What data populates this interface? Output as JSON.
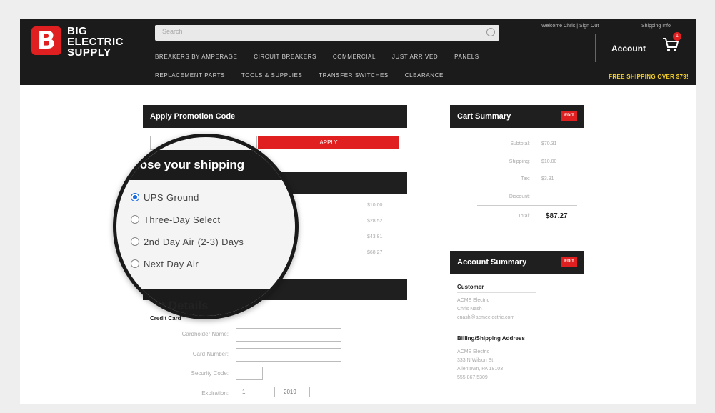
{
  "brand": {
    "line1": "BIG",
    "line2": "ELECTRIC",
    "line3": "SUPPLY",
    "logo_letter": "B"
  },
  "header": {
    "search_placeholder": "Search",
    "welcome": "Welcome Chris | Sign Out",
    "shipping_link": "Shipping Info",
    "account": "Account",
    "cart_count": "1",
    "free_shipping": "FREE SHIPPING OVER $79!",
    "nav_row1": [
      "BREAKERS BY AMPERAGE",
      "CIRCUIT BREAKERS",
      "COMMERCIAL",
      "JUST ARRIVED",
      "PANELS"
    ],
    "nav_row2": [
      "REPLACEMENT PARTS",
      "TOOLS & SUPPLIES",
      "TRANSFER SWITCHES",
      "CLEARANCE"
    ]
  },
  "promo": {
    "title": "Apply Promotion Code",
    "apply_label": "APPLY"
  },
  "shipping": {
    "magnified_heading": "hoose your shipping",
    "options": [
      {
        "label": "UPS Ground",
        "selected": true
      },
      {
        "label": "Three-Day Select",
        "selected": false
      },
      {
        "label": "2nd Day Air (2-3) Days",
        "selected": false
      },
      {
        "label": "Next Day Air",
        "selected": false
      }
    ],
    "prices": [
      "$10.00",
      "$28.52",
      "$43.81",
      "$68.27"
    ]
  },
  "payment": {
    "magnified_heading": "nt Details",
    "credit_card_label": "Credit Card",
    "fields": [
      "Cardholder Name:",
      "Card Number:",
      "Security Code:",
      "Expiration:"
    ],
    "exp_month": "1",
    "exp_year": "2019"
  },
  "cart_summary": {
    "title": "Cart Summary",
    "edit": "EDIT",
    "rows": [
      {
        "label": "Subtotal:",
        "value": "$70.31"
      },
      {
        "label": "Shipping:",
        "value": "$10.00"
      },
      {
        "label": "Tax:",
        "value": "$3.91"
      },
      {
        "label": "Discount:",
        "value": ""
      }
    ],
    "total_label": "Total:",
    "total_value": "$87.27"
  },
  "account_summary": {
    "title": "Account Summary",
    "edit": "EDIT",
    "customer_label": "Customer",
    "customer_lines": [
      "ACME Electric",
      "Chris Nash",
      "cnash@acmeelectric.com"
    ],
    "address_label": "Billing/Shipping Address",
    "address_lines": [
      "ACME Electric",
      "333 N Wilson St",
      "Allentown, PA 18103",
      "555.867.5309"
    ]
  },
  "colors": {
    "header_bg": "#1c1b1b",
    "accent_red": "#e02020",
    "promo_yellow": "#f5d02a",
    "radio_blue": "#1a6be0"
  }
}
